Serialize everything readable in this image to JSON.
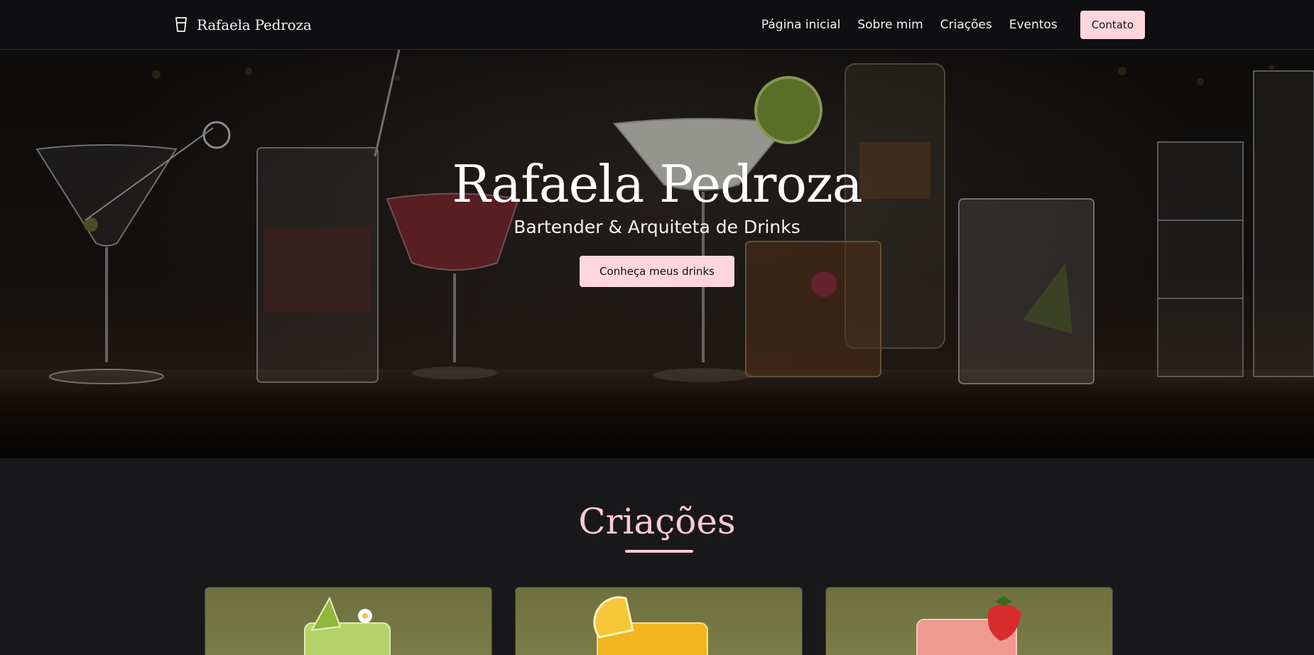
{
  "nav": {
    "brand": "Rafaela Pedroza",
    "links": [
      "Página inicial",
      "Sobre mim",
      "Criações",
      "Eventos"
    ],
    "cta": "Contato"
  },
  "hero": {
    "title": "Rafaela Pedroza",
    "subtitle": "Bartender & Arquiteta de Drinks",
    "button": "Conheça meus drinks"
  },
  "creations": {
    "title": "Criações",
    "cards": [
      {
        "name": "green-drink",
        "accent": "#b5d26a"
      },
      {
        "name": "orange-drink",
        "accent": "#f2b51f"
      },
      {
        "name": "pink-drink",
        "accent": "#ee9a92"
      }
    ]
  },
  "colors": {
    "accent": "#ffc9d3",
    "button": "#ffd6de",
    "background": "#18181b",
    "nav": "#0f0f12"
  }
}
